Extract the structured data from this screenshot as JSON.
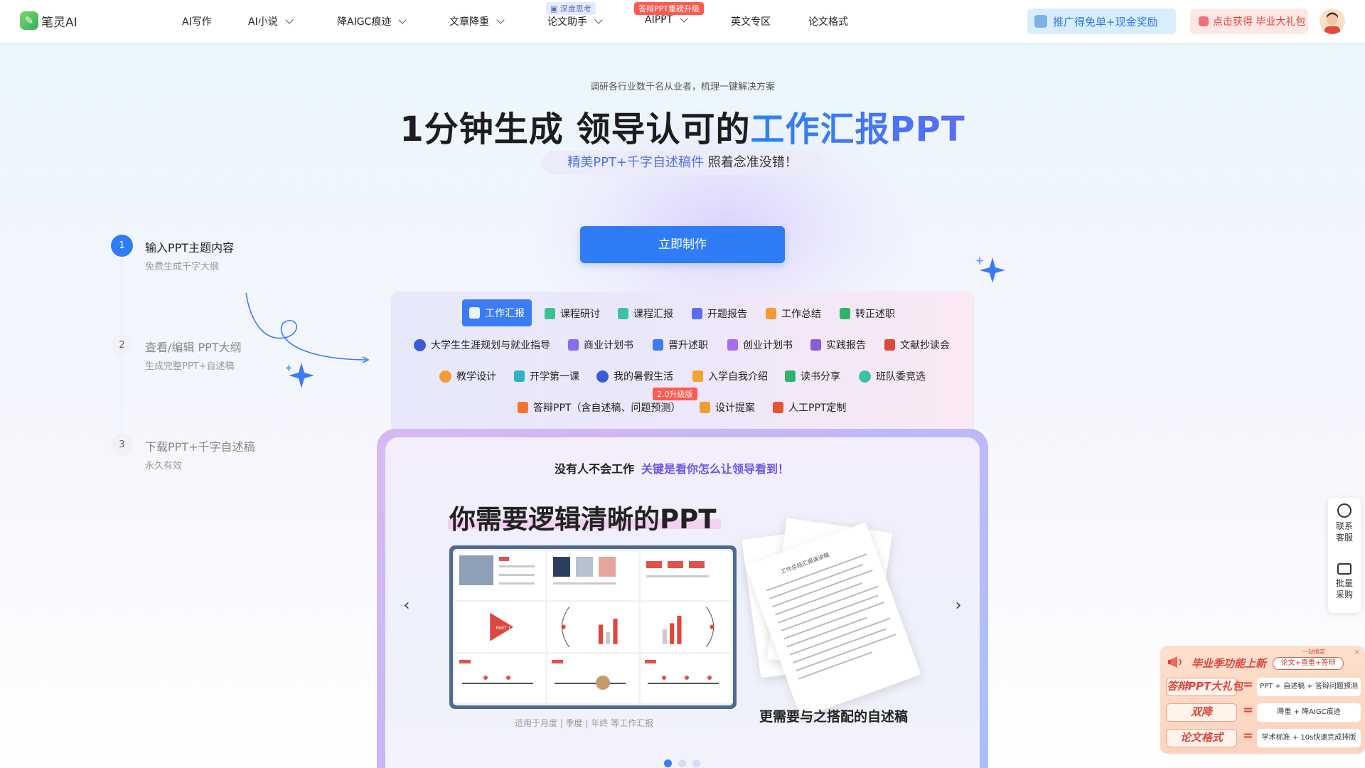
{
  "brand": {
    "name": "笔灵AI"
  },
  "nav": {
    "items": [
      {
        "label": "AI写作",
        "has_dropdown": false
      },
      {
        "label": "AI小说",
        "has_dropdown": true
      },
      {
        "label": "降AIGC痕迹",
        "has_dropdown": true
      },
      {
        "label": "文章降重",
        "has_dropdown": true
      },
      {
        "label": "论文助手",
        "has_dropdown": true,
        "badge": "深度思考"
      },
      {
        "label": "AIPPT",
        "has_dropdown": true,
        "badge": "答辩PPT重磅升级"
      },
      {
        "label": "英文专区",
        "has_dropdown": false
      },
      {
        "label": "论文格式",
        "has_dropdown": false
      }
    ],
    "promo_referral": "推广得免单+现金奖励",
    "promo_gift": "点击获得 毕业大礼包"
  },
  "hero": {
    "subtitle": "调研各行业数千名从业者，梳理一键解决方案",
    "title_plain": "1分钟生成 领导认可的",
    "title_highlight": "工作汇报PPT",
    "tag_highlight": "精美PPT+千字自述稿件",
    "tag_plain": " 照着念准没错！",
    "cta": "立即制作"
  },
  "steps": [
    {
      "num": "1",
      "title": "输入PPT主题内容",
      "desc": "免费生成千字大纲",
      "active": true
    },
    {
      "num": "2",
      "title": "查看/编辑 PPT大纲",
      "desc": "生成完整PPT+自述稿",
      "active": false
    },
    {
      "num": "3",
      "title": "下载PPT+千字自述稿",
      "desc": "永久有效",
      "active": false
    }
  ],
  "categories": {
    "row1": [
      "工作汇报",
      "课程研讨",
      "课程汇报",
      "开题报告",
      "工作总结",
      "转正述职"
    ],
    "row2": [
      "大学生生涯规划与就业指导",
      "商业计划书",
      "晋升述职",
      "创业计划书",
      "实践报告",
      "文献抄读会"
    ],
    "row3": [
      "教学设计",
      "开学第一课",
      "我的暑假生活",
      "入学自我介绍",
      "读书分享",
      "班队委竞选"
    ],
    "row4": [
      "答辩PPT（含自述稿、问题预测）",
      "设计提案",
      "人工PPT定制"
    ],
    "selected": "工作汇报",
    "upgrade_badge": "2.0升级版",
    "icon_colors": {
      "工作汇报": "#ffffff",
      "课程研讨": "#3cc18e",
      "课程汇报": "#3cc1a8",
      "开题报告": "#5b6cf5",
      "工作总结": "#f39c2f",
      "转正述职": "#2fb36b",
      "大学生生涯规划与就业指导": "#3a5bd9",
      "商业计划书": "#8a6cf0",
      "晋升述职": "#3b7cf4",
      "创业计划书": "#a86cf0",
      "实践报告": "#8a5cd6",
      "文献抄读会": "#e0463c",
      "教学设计": "#f39c2f",
      "开学第一课": "#2fb3c4",
      "我的暑假生活": "#3a5bd9",
      "入学自我介绍": "#f3a32f",
      "读书分享": "#2fb36b",
      "班队委竞选": "#3cc1a8",
      "答辩PPT（含自述稿、问题预测）": "#f3742f",
      "设计提案": "#f39c2f",
      "人工PPT定制": "#e8542f"
    }
  },
  "showcase": {
    "headline": "没有人不会工作",
    "headline_highlight": "关键是看你怎么让领导看到！",
    "title": "你需要逻辑清晰的PPT",
    "caption_left": "适用于月度 | 季度 | 年终 等工作汇报",
    "caption_right": "更需要与之搭配的自述稿",
    "slide_label": "PART 1",
    "paper_title": "工作总结汇报演讲稿",
    "prev": "‹",
    "next": "›",
    "page_count": 3,
    "active_page": 1
  },
  "side_panel": {
    "contact": "联系\n客服",
    "bulk": "批量\n采购"
  },
  "promo_card": {
    "title": "毕业季功能上新",
    "pill_label": "一站搞定",
    "pill": "论文+查重+答辩",
    "rows": [
      {
        "label": "答辩PPT大礼包",
        "value": "PPT + 自述稿 + 答辩问题预测"
      },
      {
        "label": "双降",
        "value": "降重 + 降AIGC痕迹"
      },
      {
        "label": "论文格式",
        "value": "学术标准 + 10s快速完成排版"
      }
    ],
    "close": "×"
  },
  "colors": {
    "accent": "#2f7cf6",
    "highlight_gradient": [
      "#2a84f0",
      "#5b6cf5"
    ],
    "promo_red": "#e0463c"
  }
}
